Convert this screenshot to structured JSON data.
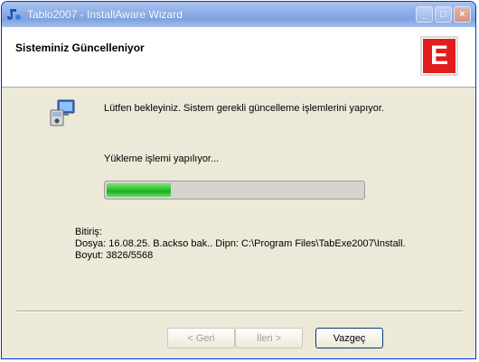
{
  "window": {
    "title": "Tablo2007 - InstallAware Wizard",
    "controls": {
      "minimize": "_",
      "maximize": "□",
      "close": "×"
    }
  },
  "header": {
    "title": "Sisteminiz Güncelleniyor",
    "logo_letter": "E",
    "logo_color": "#e31d1d"
  },
  "body": {
    "status_text": "Lütfen bekleyiniz. Sistem gerekli güncelleme işlemlerini yapıyor.",
    "progress_label": "Yükleme işlemi yapılıyor...",
    "progress_fraction": 0.25,
    "progress_color": "#2cc42c",
    "details": {
      "heading": "Bitiriş:",
      "line1": "Dosya: 16.08.25. B.ackso bak.. Dipn: C:\\Program Files\\TabExe2007\\Install.",
      "line2": "Boyut: 3826/5568"
    }
  },
  "buttons": {
    "back": "< Geri",
    "next": "İleri >",
    "cancel": "Vazgeç"
  }
}
